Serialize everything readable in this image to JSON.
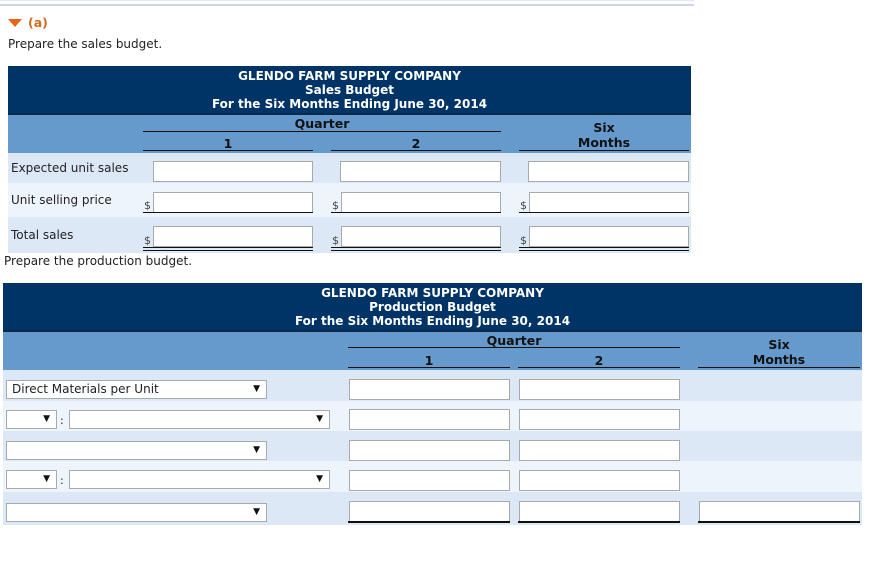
{
  "part": {
    "label": "(a)",
    "icon": "triangle-down-icon"
  },
  "sales_instruction": "Prepare the sales budget.",
  "production_instruction": "Prepare the production budget.",
  "sales_budget": {
    "company": "GLENDO FARM SUPPLY COMPANY",
    "title": "Sales Budget",
    "period": "For the Six Months Ending June 30, 2014",
    "group_header": "Quarter",
    "columns": [
      "1",
      "2"
    ],
    "total_col_line1": "Six",
    "total_col_line2": "Months",
    "currency": "$",
    "rows": [
      {
        "label": "Expected unit sales",
        "values": [
          "",
          "",
          ""
        ]
      },
      {
        "label": "Unit selling price",
        "values": [
          "",
          "",
          ""
        ]
      },
      {
        "label": "Total sales",
        "values": [
          "",
          "",
          ""
        ]
      }
    ]
  },
  "production_budget": {
    "company": "GLENDO FARM SUPPLY COMPANY",
    "title": "Production Budget",
    "period": "For the Six Months Ending June 30, 2014",
    "group_header": "Quarter",
    "columns": [
      "1",
      "2"
    ],
    "total_col_line1": "Six",
    "total_col_line2": "Months",
    "rows": [
      {
        "select": "Direct Materials per Unit",
        "values": [
          "",
          ""
        ]
      },
      {
        "op_select": "",
        "select": "",
        "values": [
          "",
          ""
        ]
      },
      {
        "select": "",
        "values": [
          "",
          ""
        ]
      },
      {
        "op_select": "",
        "select": "",
        "values": [
          "",
          ""
        ]
      },
      {
        "select": "",
        "values": [
          "",
          "",
          ""
        ]
      }
    ],
    "colon": ":"
  }
}
